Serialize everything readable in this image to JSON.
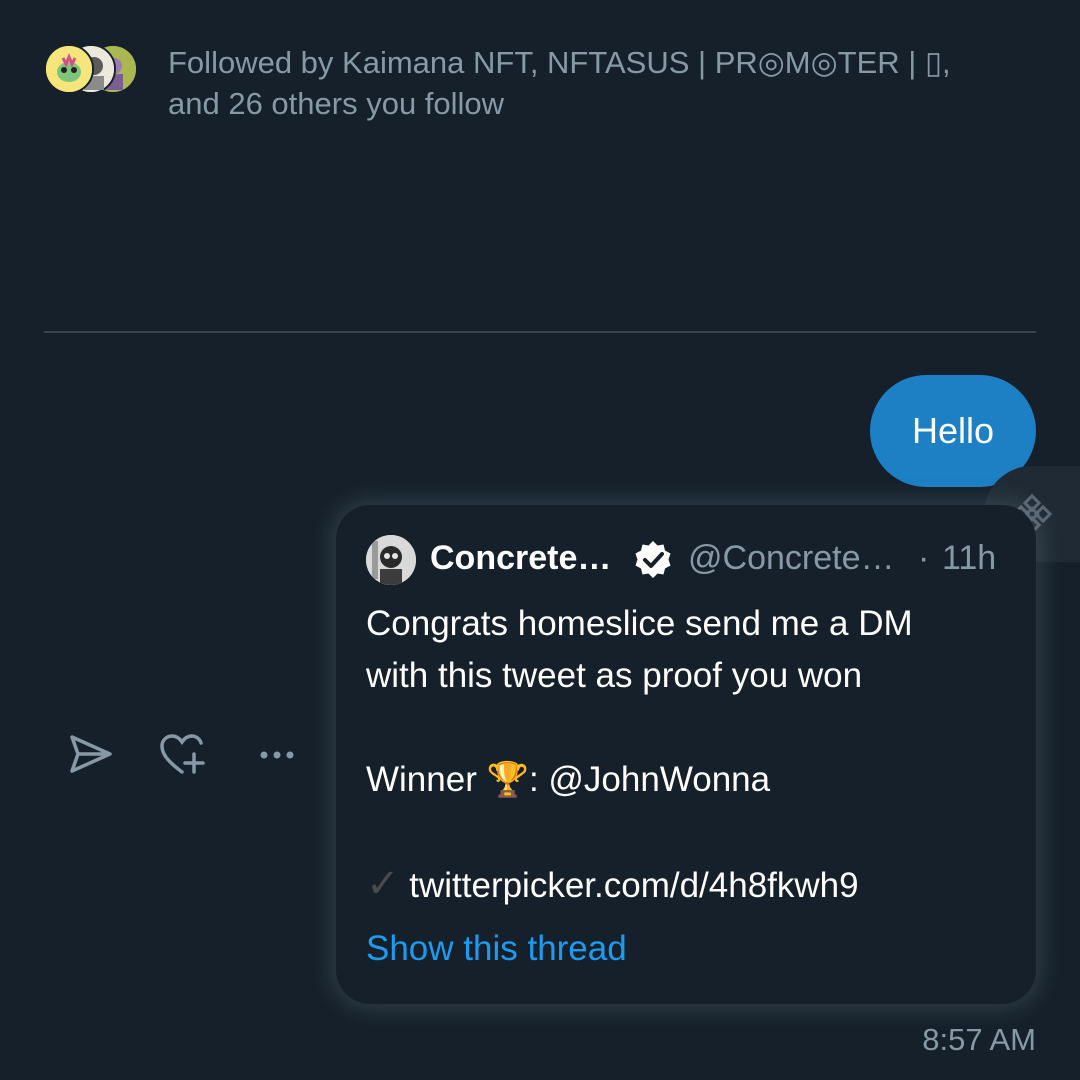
{
  "profile_card": {
    "followed_line1": "Followed by Kaimana NFT, NFTASUS | PR◎M◎TER | ▯,",
    "followed_line2": "and 26 others you follow"
  },
  "message": {
    "text": "Hello"
  },
  "tweet": {
    "name": "Concrete…",
    "handle": "@Concrete…",
    "separator": "·",
    "time": "11h",
    "line1": "Congrats homeslice send me a DM",
    "line2": "with this tweet as proof you won",
    "winner_label": "Winner",
    "winner_emoji": "🏆",
    "winner_handle": ": @JohnWonna",
    "check_glyph": "✓",
    "url": "twitterpicker.com/d/4h8fkwh9",
    "show_thread": "Show this thread"
  },
  "timestamp": "8:57 AM",
  "icons": {
    "send": "send-icon",
    "react": "heart-plus-icon",
    "more": "more-icon",
    "fab": "binance-icon",
    "verified": "verified-badge-icon"
  },
  "colors": {
    "background": "#15202b",
    "bubble": "#1d7fc4",
    "link": "#1d9bf0",
    "muted": "#8899a6"
  }
}
